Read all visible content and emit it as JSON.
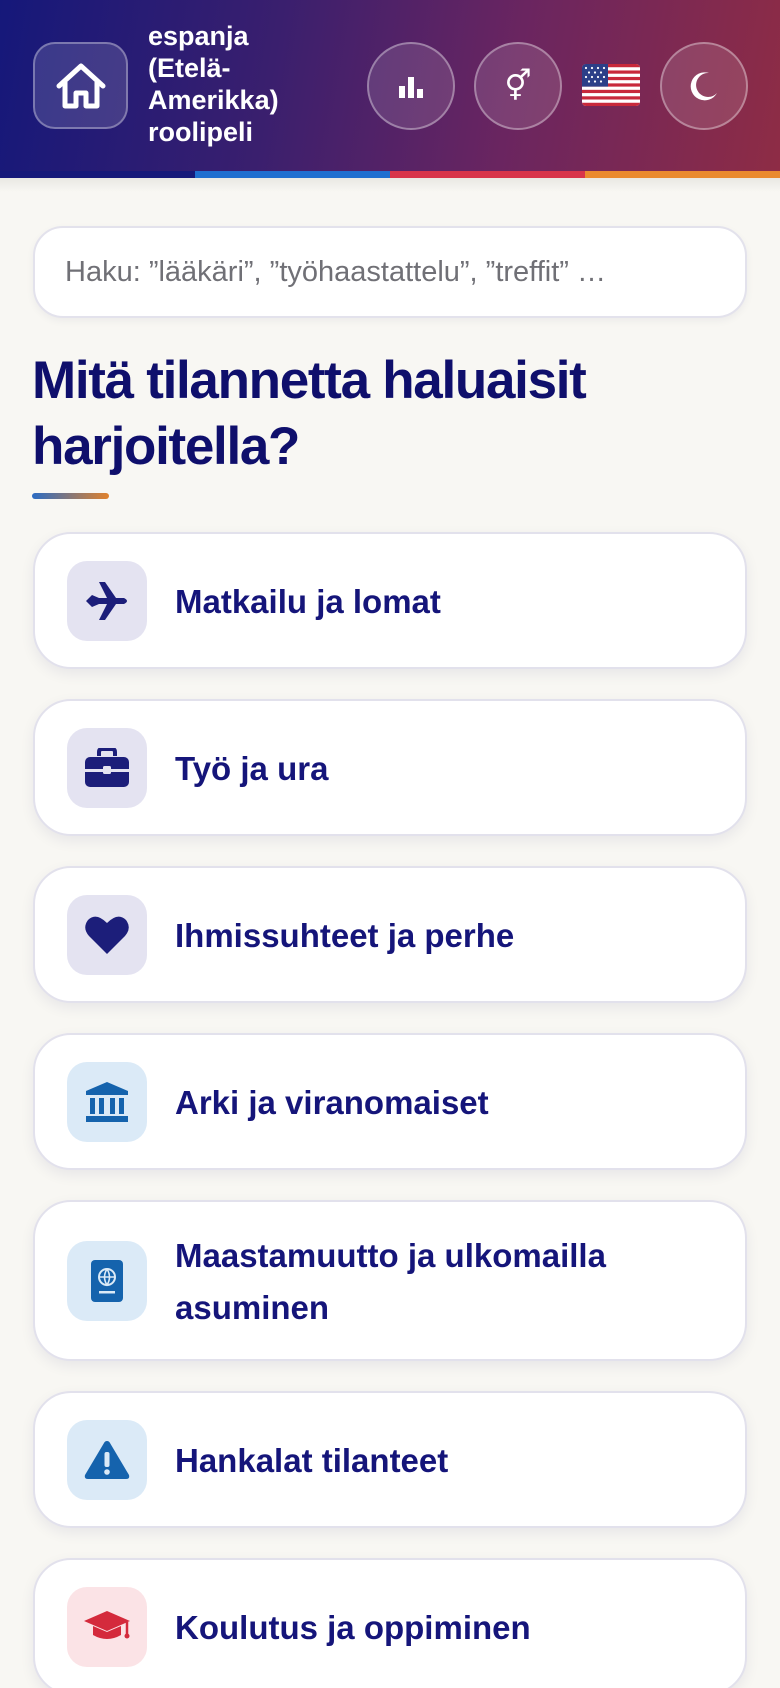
{
  "header": {
    "title": "espanja (Etelä-Amerikka) roolipeli",
    "home_icon": "home-icon",
    "stats_icon": "bar-chart-icon",
    "gender_icon": "gender-icon",
    "gender_glyph": "⚥",
    "flag_icon": "us-flag-icon",
    "theme_icon": "moon-icon",
    "stripe_colors": [
      "#16197a",
      "#1f6fd0",
      "#d8344a",
      "#ea8a2e"
    ]
  },
  "search": {
    "placeholder": "Haku: ”lääkäri”, ”työhaastattelu”, ”treffit” …"
  },
  "heading": "Mitä tilannetta haluaisit harjoitella?",
  "categories": [
    {
      "label": "Matkailu ja lomat",
      "icon": "airplane-icon",
      "icon_bg": "#e4e3f1",
      "icon_color": "#1c1e7a"
    },
    {
      "label": "Työ ja ura",
      "icon": "briefcase-icon",
      "icon_bg": "#e4e3f1",
      "icon_color": "#1c1e7a"
    },
    {
      "label": "Ihmissuhteet ja perhe",
      "icon": "heart-icon",
      "icon_bg": "#e4e3f1",
      "icon_color": "#1c1e7a"
    },
    {
      "label": "Arki ja viranomaiset",
      "icon": "bank-icon",
      "icon_bg": "#dbeaf7",
      "icon_color": "#1563ad"
    },
    {
      "label": "Maastamuutto ja ulkomailla asuminen",
      "icon": "passport-icon",
      "icon_bg": "#dbeaf7",
      "icon_color": "#1563ad"
    },
    {
      "label": "Hankalat tilanteet",
      "icon": "warning-icon",
      "icon_bg": "#dbeaf7",
      "icon_color": "#1563ad"
    },
    {
      "label": "Koulutus ja oppiminen",
      "icon": "graduation-cap-icon",
      "icon_bg": "#fbe3e6",
      "icon_color": "#d42a3c"
    }
  ]
}
